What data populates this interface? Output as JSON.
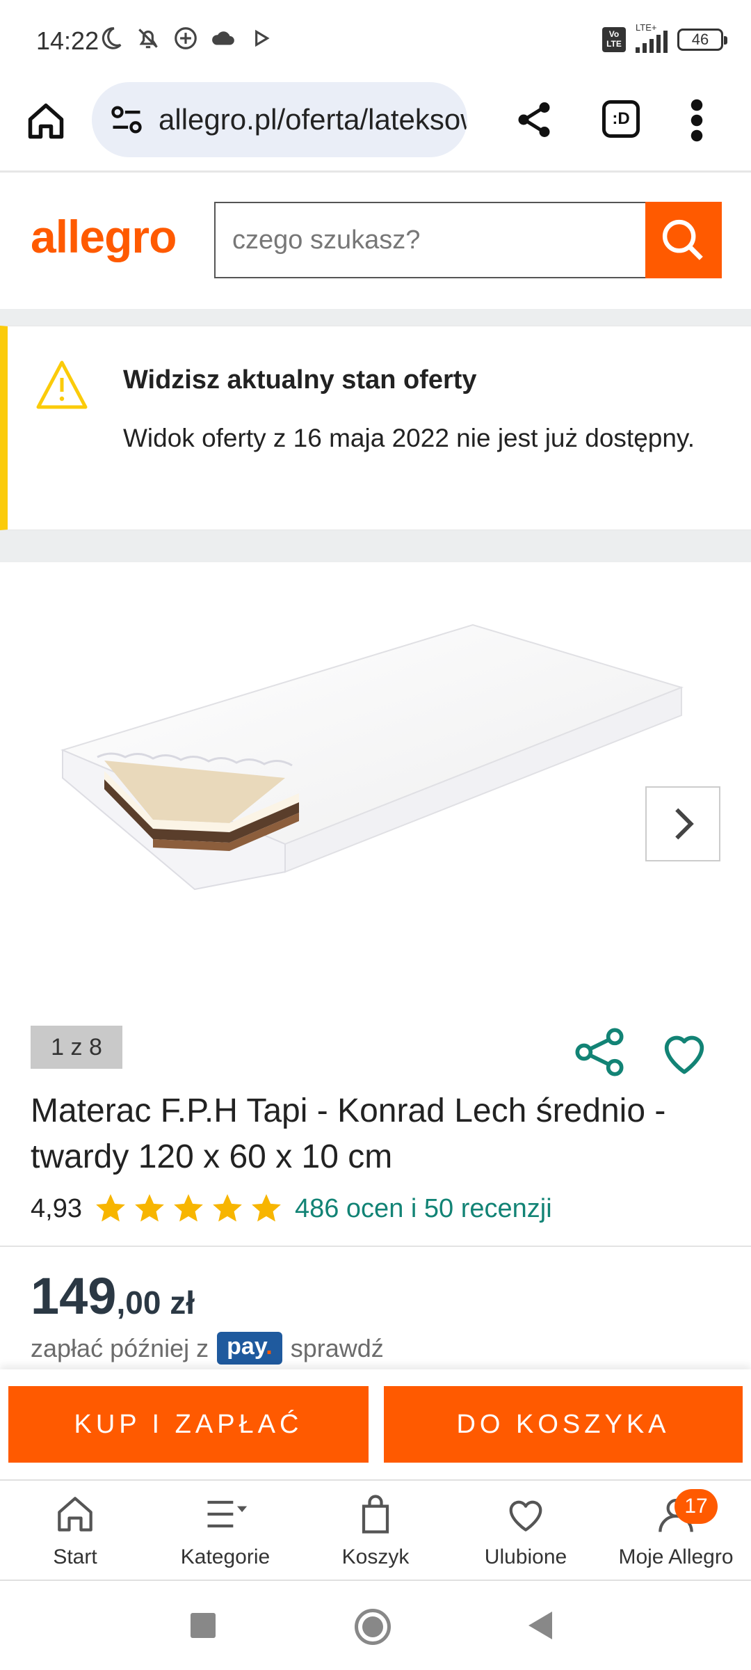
{
  "status_bar": {
    "time": "14:22",
    "network": "LTE+",
    "battery": "46"
  },
  "browser": {
    "url": "allegro.pl/oferta/lateksowy",
    "tabs_label": ":D"
  },
  "header": {
    "logo": "allegro",
    "search_placeholder": "czego szukasz?"
  },
  "notice": {
    "title": "Widzisz aktualny stan oferty",
    "text": "Widok oferty z 16 maja 2022 nie jest już dostępny."
  },
  "gallery": {
    "counter": "1 z 8"
  },
  "product": {
    "title": "Materac F.P.H Tapi - Konrad Lech średnio - twardy 120 x 60 x 10 cm",
    "rating": "4,93",
    "stars": 5,
    "reviews": "486 ocen i 50 recenzji",
    "price_int": "149",
    "price_dec": ",00",
    "price_currency": " zł",
    "paylater_prefix": "zapłać później z",
    "pay_badge": "pay",
    "paylater_link": "sprawdź"
  },
  "actions": {
    "buy": "KUP I ZAPŁAĆ",
    "cart": "DO KOSZYKA"
  },
  "bottom_nav": {
    "items": [
      {
        "label": "Start"
      },
      {
        "label": "Kategorie"
      },
      {
        "label": "Koszyk"
      },
      {
        "label": "Ulubione"
      },
      {
        "label": "Moje Allegro",
        "badge": "17"
      }
    ]
  },
  "colors": {
    "brand": "#ff5a00",
    "accent_green": "#128375",
    "notice_yellow": "#fbcb0a",
    "star": "#f7b500"
  }
}
